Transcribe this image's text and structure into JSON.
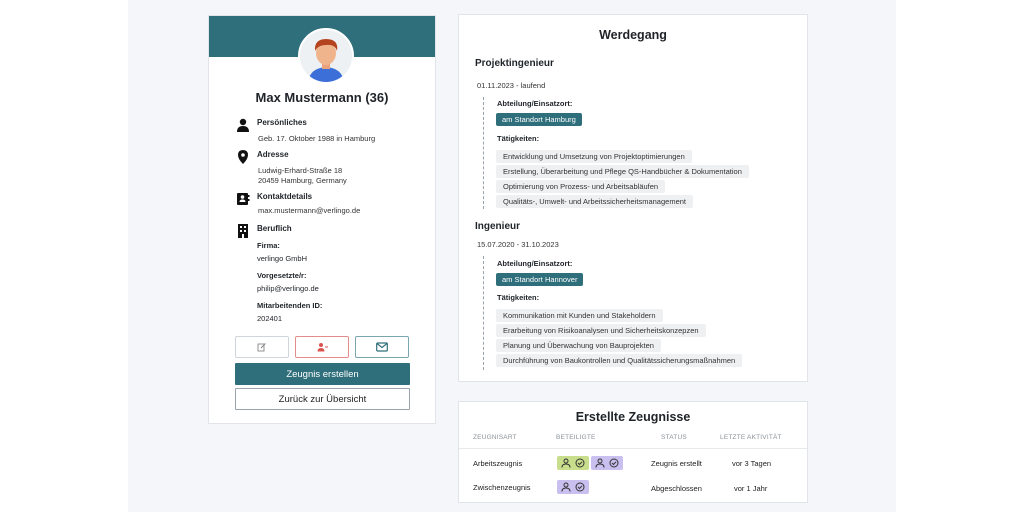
{
  "profile": {
    "name": "Max Mustermann (36)",
    "personal": {
      "title": "Persönliches",
      "birth": "Geb. 17. Oktober 1988 in Hamburg"
    },
    "address": {
      "title": "Adresse",
      "line1": "Ludwig-Erhard-Straße 18",
      "line2": "20459 Hamburg, Germany"
    },
    "contact": {
      "title": "Kontaktdetails",
      "email": "max.mustermann@verlingo.de"
    },
    "work": {
      "title": "Beruflich",
      "company_label": "Firma:",
      "company": "verlingo GmbH",
      "supervisor_label": "Vorgesetzte/r:",
      "supervisor": "philip@verlingo.de",
      "id_label": "Mitarbeitenden ID:",
      "id": "202401"
    },
    "actions": {
      "create": "Zeugnis erstellen",
      "back": "Zurück zur Übersicht"
    }
  },
  "career": {
    "title": "Werdegang",
    "dept_label": "Abteilung/Einsatzort:",
    "tasks_label": "Tätigkeiten:",
    "jobs": [
      {
        "title": "Projektingenieur",
        "date": "01.11.2023 - laufend",
        "location": "am Standort Hamburg",
        "tasks": [
          "Entwicklung und Umsetzung von Projektoptimierungen",
          "Erstellung, Überarbeitung und Pflege QS-Handbücher & Dokumentation",
          "Optimierung von Prozess- und Arbeitsabläufen",
          "Qualitäts-, Umwelt- und Arbeitssicherheitsmanagement"
        ]
      },
      {
        "title": "Ingenieur",
        "date": "15.07.2020 - 31.10.2023",
        "location": "am Standort Hannover",
        "tasks": [
          "Kommunikation mit Kunden und Stakeholdern",
          "Erarbeitung von Risikoanalysen und Sicherheitskonzepzen",
          "Planung und Überwachung von Bauprojekten",
          "Durchführung von Baukontrollen und Qualitätssicherungsmaßnahmen"
        ]
      }
    ]
  },
  "certificates": {
    "title": "Erstellte Zeugnisse",
    "columns": [
      "ZEUGNISART",
      "BETEILIGTE",
      "STATUS",
      "LETZTE AKTIVITÄT"
    ],
    "rows": [
      {
        "type": "Arbeitszeugnis",
        "status": "Zeugnis erstellt",
        "activity": "vor 3 Tagen"
      },
      {
        "type": "Zwischenzeugnis",
        "status": "Abgeschlossen",
        "activity": "vor 1 Jahr"
      }
    ]
  },
  "colors": {
    "accent": "#2f6f7b",
    "background": "#f4f6f9",
    "participant_green": "#c9de8c",
    "participant_purple": "#c9c0ef"
  }
}
